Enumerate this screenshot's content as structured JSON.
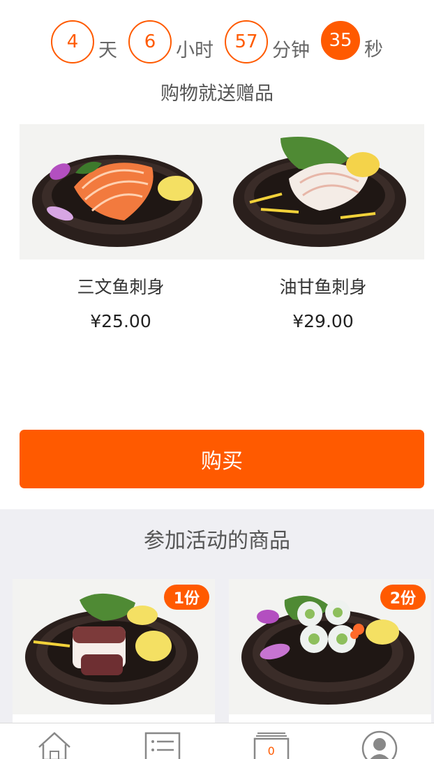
{
  "countdown": {
    "days": "4",
    "days_label": "天",
    "hours": "6",
    "hours_label": "小时",
    "minutes": "57",
    "minutes_label": "分钟",
    "seconds": "35",
    "seconds_label": "秒"
  },
  "gift_section": {
    "title": "购物就送赠品",
    "items": [
      {
        "name": "三文鱼刺身",
        "price": "¥25.00",
        "image": "salmon-sashimi-plate"
      },
      {
        "name": "油甘鱼刺身",
        "price": "¥29.00",
        "image": "yellowtail-sashimi-plate"
      }
    ]
  },
  "buy_button": {
    "label": "购买"
  },
  "activity_section": {
    "title": "参加活动的商品",
    "items": [
      {
        "badge": "1份",
        "image": "octopus-sashimi-plate"
      },
      {
        "badge": "2份",
        "image": "sushi-roll-plate"
      }
    ]
  },
  "tabbar": {
    "tabs": [
      {
        "icon": "home-icon"
      },
      {
        "icon": "list-icon"
      },
      {
        "icon": "cart-icon",
        "count": "0"
      },
      {
        "icon": "user-icon"
      }
    ]
  },
  "colors": {
    "accent": "#ff5a00",
    "section_bg": "#efeff3"
  }
}
